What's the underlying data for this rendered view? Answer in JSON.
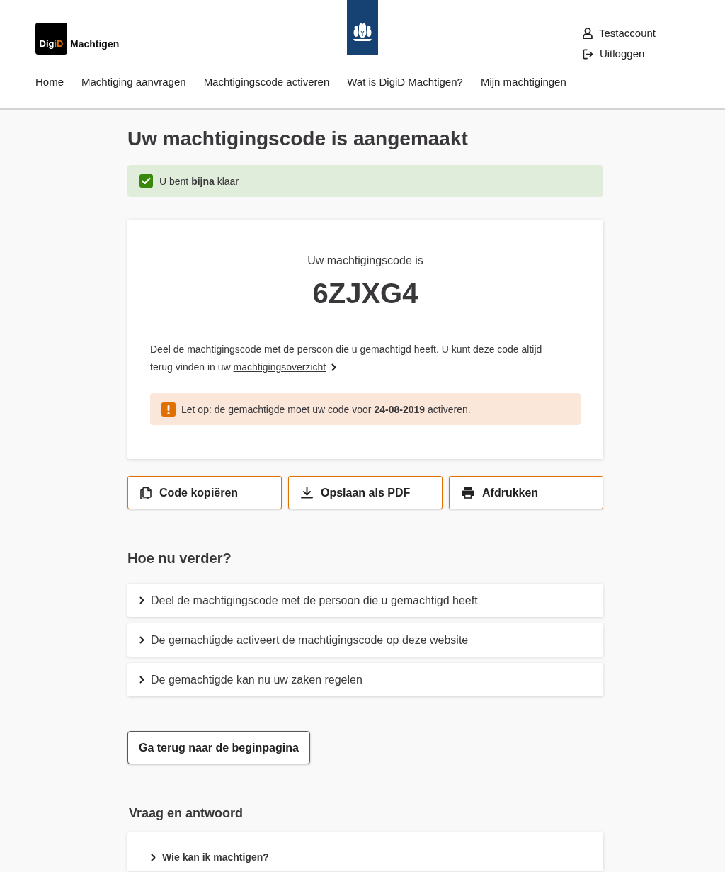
{
  "header": {
    "logo": {
      "text": "Dig",
      "accent": "iD",
      "title": "Machtigen"
    },
    "user_menu": [
      {
        "kind": "account",
        "label": "Testaccount"
      },
      {
        "kind": "logout",
        "label": "Uitloggen"
      }
    ]
  },
  "nav": {
    "items": [
      {
        "label": "Home"
      },
      {
        "label": "Machtiging aanvragen"
      },
      {
        "label": "Machtigingscode activeren"
      },
      {
        "label": "Wat is DigiD Machtigen?"
      },
      {
        "label": "Mijn machtigingen"
      }
    ]
  },
  "page_title": "Uw machtigingscode is aangemaakt",
  "success_alert": {
    "text": "U bent **bijna** klaar"
  },
  "code_card": {
    "label": "Uw machtigingscode is",
    "code": "6ZJXG4",
    "description": "Deel de machtigingscode met de persoon die u gemachtigd heeft. U kunt deze code altijd terug vinden in uw",
    "link": "machtigingsoverzicht",
    "warning": "Let op: de gemachtigde moet uw code voor **24-08-2019** activeren."
  },
  "actions": [
    {
      "kind": "copy",
      "label": "Code kopiëren"
    },
    {
      "kind": "download",
      "label": "Opslaan als PDF"
    },
    {
      "kind": "print",
      "label": "Afdrukken"
    }
  ],
  "next_steps": {
    "title": "Hoe nu verder?",
    "items": [
      {
        "label": "Deel de machtigingscode met de persoon die u gemachtigd heeft",
        "expanded": false
      },
      {
        "label": "De gemachtigde activeert de machtigingscode op deze website",
        "expanded": false
      },
      {
        "label": "De gemachtigde kan nu uw zaken regelen",
        "expanded": false
      }
    ]
  },
  "back_button": "Ga terug naar de beginpagina",
  "faq": {
    "title": "Vraag en antwoord",
    "items": [
      {
        "label": "Wie kan ik machtigen?",
        "expanded": false
      }
    ]
  }
}
